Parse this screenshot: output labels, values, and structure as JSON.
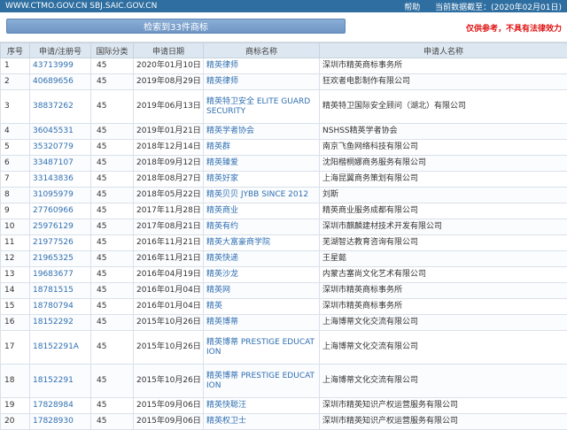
{
  "topbar": {
    "sites": "WWW.CTMO.GOV.CN SBJ.SAIC.GOV.CN",
    "help": "帮助",
    "date_label": "当前数据截至：(2020年02月01日)"
  },
  "banner": {
    "search_result": "检索到33件商标",
    "notice": "仅供参考，不具有法律效力"
  },
  "table": {
    "headers": [
      "序号",
      "申请/注册号",
      "国际分类",
      "申请日期",
      "商标名称",
      "申请人名称"
    ],
    "rows": [
      {
        "idx": "1",
        "reg_no": "43713999",
        "cls": "45",
        "date": "2020年01月10日",
        "name": "精英律师",
        "applicant": "深圳市精英商标事务所"
      },
      {
        "idx": "2",
        "reg_no": "40689656",
        "cls": "45",
        "date": "2019年08月29日",
        "name": "精英律师",
        "applicant": "狂欢者电影制作有限公司"
      },
      {
        "idx": "3",
        "reg_no": "38837262",
        "cls": "45",
        "date": "2019年06月13日",
        "name": "精英特卫安全 ELITE GUARD SECURITY",
        "applicant": "精英特卫国际安全顾问（湖北）有限公司"
      },
      {
        "idx": "4",
        "reg_no": "36045531",
        "cls": "45",
        "date": "2019年01月21日",
        "name": "精英学者协会",
        "applicant": "NSHSS精英学者协会"
      },
      {
        "idx": "5",
        "reg_no": "35320779",
        "cls": "45",
        "date": "2018年12月14日",
        "name": "精英群",
        "applicant": "南京飞鱼网络科技有限公司"
      },
      {
        "idx": "6",
        "reg_no": "33487107",
        "cls": "45",
        "date": "2018年09月12日",
        "name": "精英臻爱",
        "applicant": "沈阳楷桐娜商务服务有限公司"
      },
      {
        "idx": "7",
        "reg_no": "33143836",
        "cls": "45",
        "date": "2018年08月27日",
        "name": "精英好家",
        "applicant": "上海昆翼商务策划有限公司"
      },
      {
        "idx": "8",
        "reg_no": "31095979",
        "cls": "45",
        "date": "2018年05月22日",
        "name": "精英贝贝 JYBB SINCE 2012",
        "applicant": "刘斯"
      },
      {
        "idx": "9",
        "reg_no": "27760966",
        "cls": "45",
        "date": "2017年11月28日",
        "name": "精英商业",
        "applicant": "精英商业服务成都有限公司"
      },
      {
        "idx": "10",
        "reg_no": "25976129",
        "cls": "45",
        "date": "2017年08月21日",
        "name": "精英有约",
        "applicant": "深圳市麒麟建材技术开发有限公司"
      },
      {
        "idx": "11",
        "reg_no": "21977526",
        "cls": "45",
        "date": "2016年11月21日",
        "name": "精英大富豪商学院",
        "applicant": "芜湖智达教育咨询有限公司"
      },
      {
        "idx": "12",
        "reg_no": "21965325",
        "cls": "45",
        "date": "2016年11月21日",
        "name": "精英快递",
        "applicant": "王星懿"
      },
      {
        "idx": "13",
        "reg_no": "19683677",
        "cls": "45",
        "date": "2016年04月19日",
        "name": "精英沙龙",
        "applicant": "内蒙古塞尚文化艺术有限公司"
      },
      {
        "idx": "14",
        "reg_no": "18781515",
        "cls": "45",
        "date": "2016年01月04日",
        "name": "精英网",
        "applicant": "深圳市精英商标事务所"
      },
      {
        "idx": "15",
        "reg_no": "18780794",
        "cls": "45",
        "date": "2016年01月04日",
        "name": "精英",
        "applicant": "深圳市精英商标事务所"
      },
      {
        "idx": "16",
        "reg_no": "18152292",
        "cls": "45",
        "date": "2015年10月26日",
        "name": "精英博蒂",
        "applicant": "上海博蒂文化交流有限公司"
      },
      {
        "idx": "17",
        "reg_no": "18152291A",
        "cls": "45",
        "date": "2015年10月26日",
        "name": "精英博蒂 PRESTIGE EDUCATION",
        "applicant": "上海博蒂文化交流有限公司"
      },
      {
        "idx": "18",
        "reg_no": "18152291",
        "cls": "45",
        "date": "2015年10月26日",
        "name": "精英博蒂 PRESTIGE EDUCATION",
        "applicant": "上海博蒂文化交流有限公司"
      },
      {
        "idx": "19",
        "reg_no": "17828984",
        "cls": "45",
        "date": "2015年09月06日",
        "name": "精英快聪汪",
        "applicant": "深圳市精英知识产权运营服务有限公司"
      },
      {
        "idx": "20",
        "reg_no": "17828930",
        "cls": "45",
        "date": "2015年09月06日",
        "name": "精英权卫士",
        "applicant": "深圳市精英知识产权运营服务有限公司"
      }
    ]
  }
}
